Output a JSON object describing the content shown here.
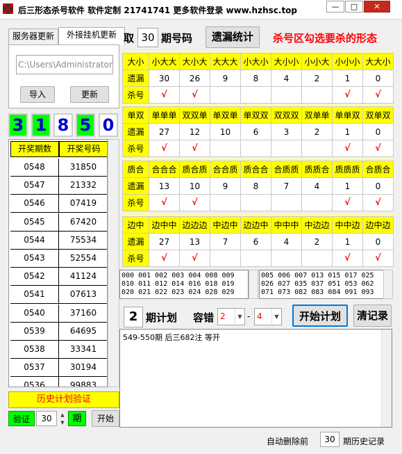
{
  "window": {
    "title": "后三形态杀号软件 软件定制 21741741 更多软件登录 www.hzhsc.top",
    "controls": {
      "minimize": "—",
      "maximize": "□",
      "close": "✕"
    }
  },
  "left": {
    "tabs": [
      "服务器更新",
      "外接挂机更新"
    ],
    "path_value": "C:\\Users\\Administrator\\",
    "import_label": "导入",
    "update_label": "更新",
    "digits": [
      {
        "value": "3",
        "bg": "#00ff00"
      },
      {
        "value": "1",
        "bg": "#00ff00"
      },
      {
        "value": "8",
        "bg": "#ffffff"
      },
      {
        "value": "5",
        "bg": "#00ff00"
      },
      {
        "value": "0",
        "bg": "#ffffff"
      }
    ],
    "history_headers": [
      "开奖期数",
      "开奖号码"
    ],
    "history": [
      [
        "0548",
        "31850"
      ],
      [
        "0547",
        "21332"
      ],
      [
        "0546",
        "07419"
      ],
      [
        "0545",
        "67420"
      ],
      [
        "0544",
        "75534"
      ],
      [
        "0543",
        "52554"
      ],
      [
        "0542",
        "41124"
      ],
      [
        "0541",
        "07613"
      ],
      [
        "0540",
        "37160"
      ],
      [
        "0539",
        "64695"
      ],
      [
        "0538",
        "33341"
      ],
      [
        "0537",
        "30194"
      ],
      [
        "0536",
        "99883"
      ]
    ],
    "verify_label": "历史计划验证",
    "verify_tag": "验证",
    "verify_count": "30",
    "verify_unit": "期",
    "start_label": "开始"
  },
  "top": {
    "take_label": "取",
    "count": "30",
    "period_label": "期号码",
    "stats_button": "遗漏统计",
    "hint": "杀号区勾选要杀的形态"
  },
  "groups": [
    {
      "name": "大小",
      "cols": [
        "小大大",
        "大小大",
        "大大大",
        "小大小",
        "大小小",
        "小小大",
        "小小小",
        "大大小"
      ],
      "miss": [
        "30",
        "26",
        "9",
        "8",
        "4",
        "2",
        "1",
        "0"
      ],
      "kill": [
        "√",
        "√",
        "",
        "",
        "",
        "",
        "√",
        "√"
      ]
    },
    {
      "name": "单双",
      "cols": [
        "单单单",
        "双双单",
        "单双单",
        "单双双",
        "双双双",
        "双单单",
        "单单双",
        "双单双"
      ],
      "miss": [
        "27",
        "12",
        "10",
        "6",
        "3",
        "2",
        "1",
        "0"
      ],
      "kill": [
        "√",
        "√",
        "",
        "",
        "",
        "",
        "√",
        "√"
      ]
    },
    {
      "name": "质合",
      "cols": [
        "合合合",
        "质合质",
        "合合质",
        "质合合",
        "合质质",
        "质质合",
        "质质质",
        "合质合"
      ],
      "miss": [
        "13",
        "10",
        "9",
        "8",
        "7",
        "4",
        "1",
        "0"
      ],
      "kill": [
        "√",
        "√",
        "",
        "",
        "",
        "",
        "√",
        "√"
      ]
    },
    {
      "name": "边中",
      "cols": [
        "边中中",
        "边边边",
        "中边中",
        "边边中",
        "中中中",
        "中边边",
        "中中边",
        "边中边"
      ],
      "miss": [
        "27",
        "13",
        "7",
        "6",
        "4",
        "2",
        "1",
        "0"
      ],
      "kill": [
        "√",
        "√",
        "",
        "",
        "",
        "",
        "√",
        "√"
      ]
    }
  ],
  "row_labels": {
    "miss": "遗漏",
    "kill": "杀号"
  },
  "numbers_left": "000 001 002 003 004 008 009\n010 011 012 014 016 018 019\n020 021 022 023 024 028 029",
  "numbers_right": "005 006 007 013 015 017 025\n026 027 035 037 051 053 062\n071 073 082 083 084 091 093",
  "plan": {
    "periods": "2",
    "periods_label": "期计划",
    "tolerance_label": "容错",
    "tol_from": "2",
    "dash": "-",
    "tol_to": "4",
    "start_button": "开始计划",
    "clear_button": "清记录"
  },
  "log_text": "549-550期 后三682注 等开",
  "footer": {
    "prefix": "自动删除前",
    "count": "30",
    "suffix": "期历史记录"
  }
}
